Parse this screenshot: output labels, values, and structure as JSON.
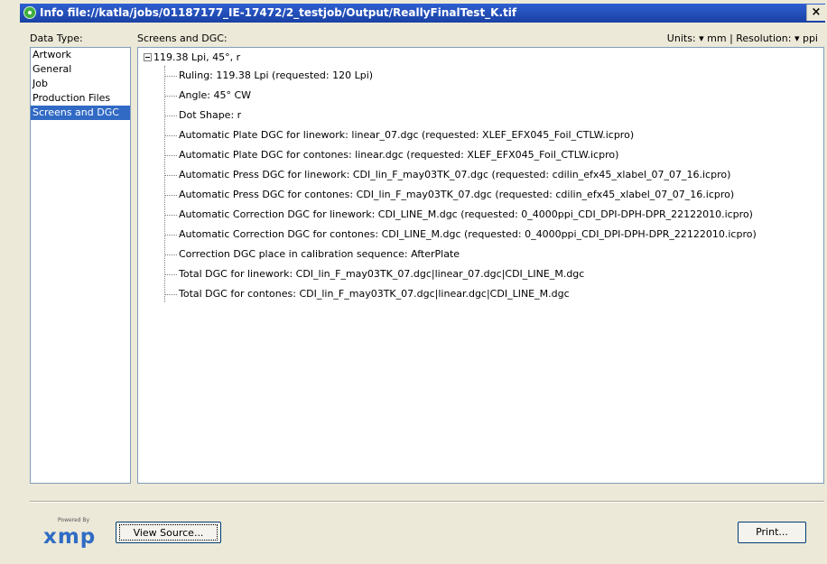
{
  "window": {
    "title": "Info file://katla/jobs/01187177_IE-17472/2_testjob/Output/ReallyFinalTest_K.tif",
    "close_glyph": "×"
  },
  "left": {
    "label": "Data Type:",
    "items": [
      "Artwork",
      "General",
      "Job",
      "Production Files",
      "Screens and DGC"
    ],
    "selected": "Screens and DGC"
  },
  "right": {
    "label": "Screens and DGC:",
    "units_text": "Units: ▾ mm | Resolution: ▾ ppi",
    "tree_root": "119.38 Lpi, 45°, r",
    "tree_items": [
      "Ruling:  119.38 Lpi   (requested: 120 Lpi)",
      "Angle:  45° CW",
      "Dot Shape:  r",
      "Automatic Plate DGC for linework:  linear_07.dgc   (requested: XLEF_EFX045_Foil_CTLW.icpro)",
      "Automatic Plate DGC for contones:  linear.dgc   (requested: XLEF_EFX045_Foil_CTLW.icpro)",
      "Automatic Press DGC for linework:  CDI_lin_F_may03TK_07.dgc   (requested: cdilin_efx45_xlabel_07_07_16.icpro)",
      "Automatic Press DGC for contones:  CDI_lin_F_may03TK_07.dgc   (requested: cdilin_efx45_xlabel_07_07_16.icpro)",
      "Automatic Correction DGC for linework:  CDI_LINE_M.dgc   (requested: 0_4000ppi_CDI_DPI-DPH-DPR_22122010.icpro)",
      "Automatic Correction DGC for contones:  CDI_LINE_M.dgc   (requested: 0_4000ppi_CDI_DPI-DPH-DPR_22122010.icpro)",
      "Correction DGC place in calibration sequence:  AfterPlate",
      "Total DGC for linework:  CDI_lin_F_may03TK_07.dgc|linear_07.dgc|CDI_LINE_M.dgc",
      "Total DGC for contones:  CDI_lin_F_may03TK_07.dgc|linear.dgc|CDI_LINE_M.dgc"
    ]
  },
  "footer": {
    "powered_by": "Powered By",
    "logo_text": "xmp",
    "view_source_label": "View Source...",
    "print_label": "Print..."
  },
  "colors": {
    "title_bar": "#1941a5",
    "selection": "#316ac5",
    "xmp_blue": "#2f6cc4"
  }
}
